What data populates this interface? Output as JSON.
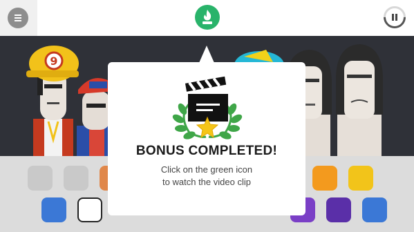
{
  "popup": {
    "title": "BONUS COMPLETED!",
    "line1": "Click on the green icon",
    "line2": "to watch the video clip"
  },
  "hats": {
    "number_badge": "9"
  },
  "colors": {
    "accent_green": "#29b36a",
    "stage_background": "#2f3138",
    "tray_background": "#dcdcdc",
    "star": "#f5c518"
  },
  "icons": [
    "menu-icon",
    "flame-icon",
    "pause-icon",
    "clapperboard-icon",
    "laurel-wreath-icon",
    "star-icon"
  ]
}
